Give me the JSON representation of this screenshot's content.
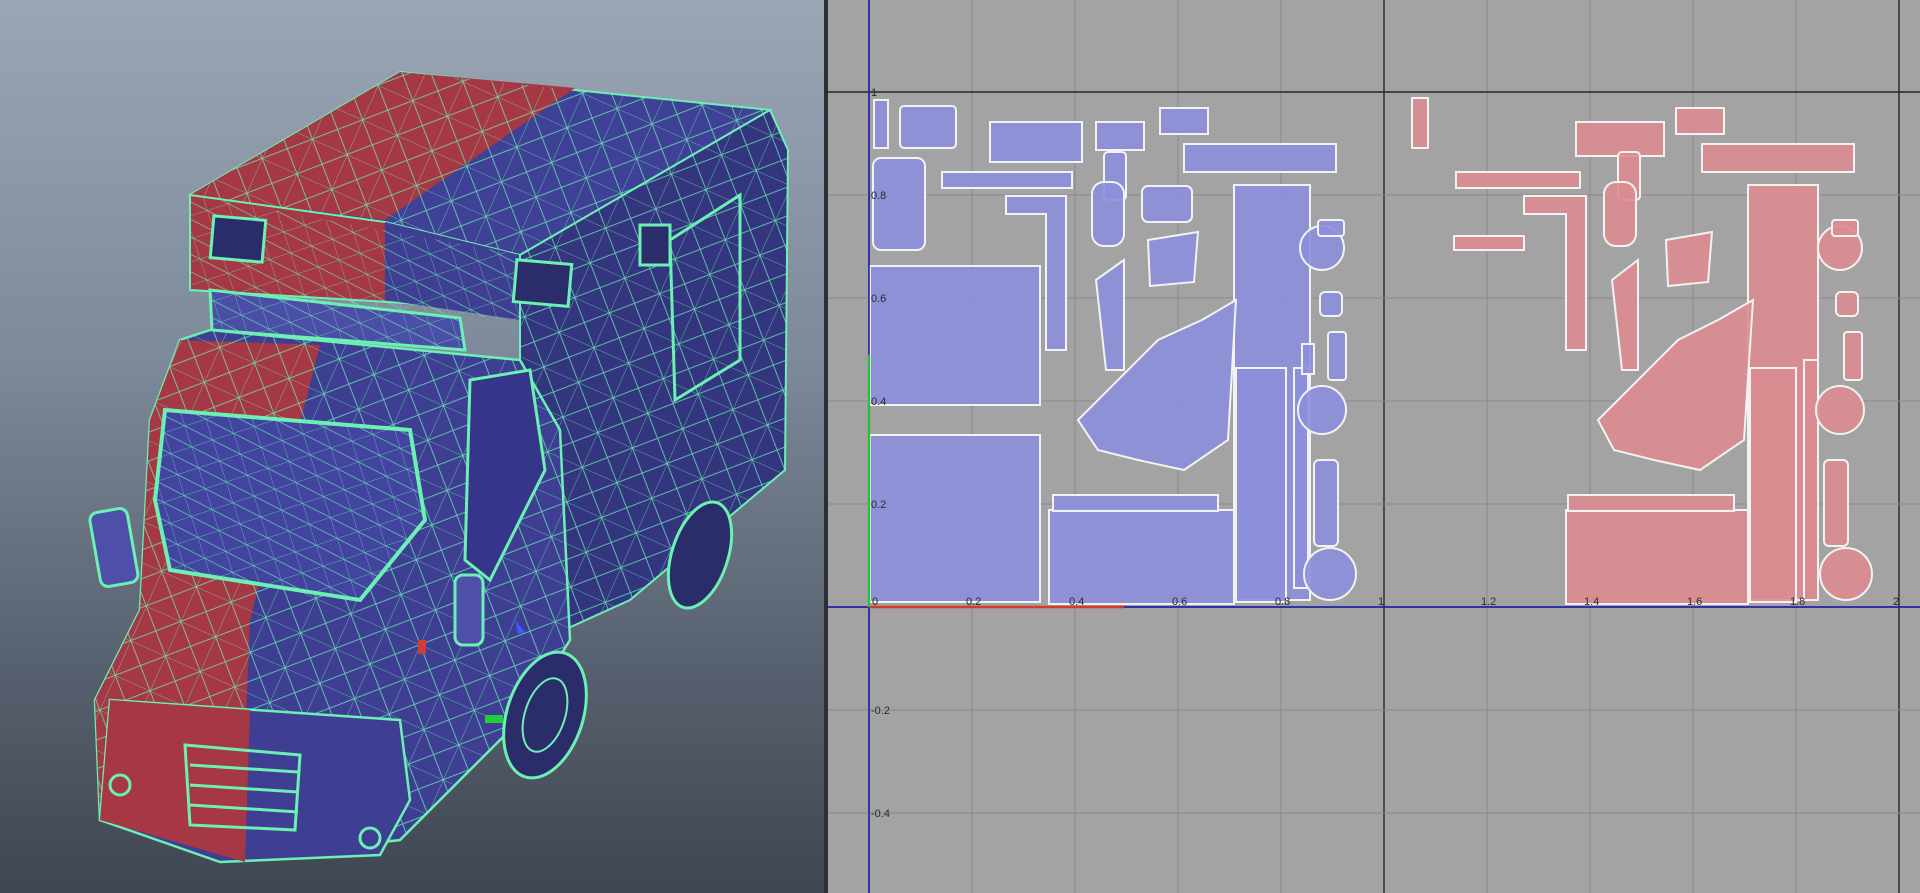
{
  "viewport": {
    "model": "ambulance",
    "display": "wireframe-on-shaded",
    "colors": {
      "background_top": "#9aa6b4",
      "background_bottom": "#3f4652",
      "wire": "#6cf0b4",
      "shell_a": "#3e3f93",
      "shell_b": "#a23744"
    }
  },
  "uv_editor": {
    "colors": {
      "background": "#a3a3a3",
      "grid": "#8a8a8a",
      "grid_major": "#262626",
      "axis_u": "#2222bb",
      "axis_v": "#2222bb",
      "shell_blue": "#8c8fdc",
      "shell_red": "#dc8c90",
      "shell_outline": "#f2f2f2"
    },
    "u_ticks": [
      "0.2",
      "0.4",
      "0.6",
      "0.8",
      "1",
      "1.2",
      "1.4",
      "1.6",
      "1.8",
      "2"
    ],
    "v_ticks": [
      "1",
      "0.8",
      "0.6",
      "0.4",
      "0.2",
      "-0.2",
      "-0.4"
    ],
    "origin_label": "0"
  }
}
